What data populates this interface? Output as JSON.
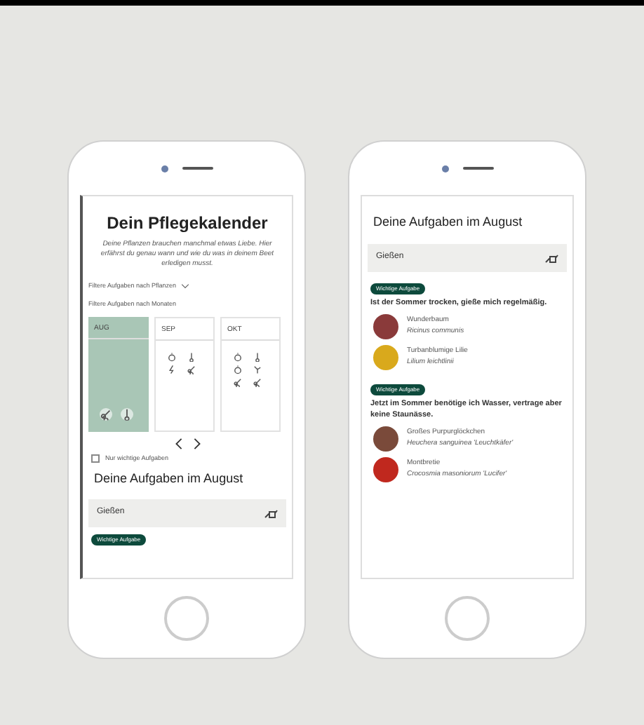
{
  "left_screen": {
    "title": "Dein Pflegekalender",
    "intro": "Deine Pflanzen brauchen manchmal etwas Liebe. Hier erfährst du genau wann und wie du was in deinem Beet erledigen musst.",
    "plant_filter": "Filtere Aufgaben nach Pflanzen",
    "month_filter": "Filtere Aufgaben nach Monaten",
    "months": [
      {
        "label": "AUG",
        "selected": true
      },
      {
        "label": "SEP",
        "selected": false
      },
      {
        "label": "OKT",
        "selected": false
      }
    ],
    "important_only": {
      "label": "Nur wichtige Aufgaben",
      "checked": false
    },
    "heading": "Deine Aufgaben im August",
    "task": "Gießen",
    "badge": "Wichtige Aufgabe"
  },
  "right_screen": {
    "heading": "Deine Aufgaben im August",
    "task": "Gießen",
    "groups": [
      {
        "badge": "Wichtige Aufgabe",
        "text": "Ist der Sommer trocken, gieße mich regelmäßig.",
        "plants": [
          {
            "name": "Wunderbaum",
            "latin": "Ricinus communis",
            "color": "#8a3a3a"
          },
          {
            "name": "Turbanblumige Lilie",
            "latin": "Lilium leichtlinii",
            "color": "#d9a91c"
          }
        ]
      },
      {
        "badge": "Wichtige Aufgabe",
        "text": "Jetzt im Sommer benötige ich Wasser, vertrage aber keine Staunässe.",
        "plants": [
          {
            "name": "Großes Purpurglöckchen",
            "latin": "Heuchera sanguinea 'Leuchtkäfer'",
            "color": "#7a4a3a"
          },
          {
            "name": "Montbretie",
            "latin": "Crocosmia masoniorum 'Lucifer'",
            "color": "#c0281e"
          }
        ]
      }
    ]
  }
}
